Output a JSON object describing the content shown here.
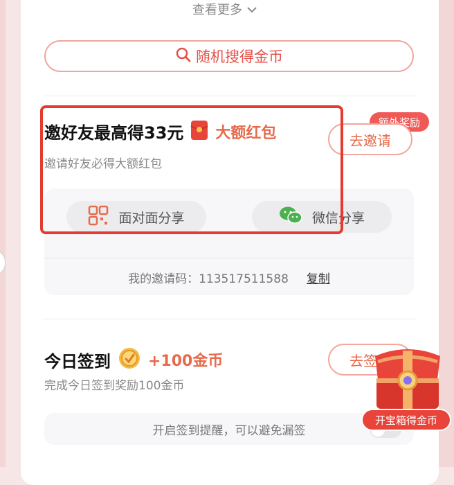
{
  "top": {
    "see_more_label": "查看更多",
    "search_button_label": "随机搜得金币"
  },
  "invite_task": {
    "title": "邀好友最高得33元",
    "tag": "大额红包",
    "description": "邀请好友必得大额红包",
    "badge": "额外奖励",
    "action_label": "去邀请",
    "share_face_label": "面对面分享",
    "share_wechat_label": "微信分享",
    "invite_code_prefix": "我的邀请码：",
    "invite_code": "113517511588",
    "copy_label": "复制"
  },
  "checkin_task": {
    "title": "今日签到",
    "reward": "+100金币",
    "description": "完成今日签到奖励100金币",
    "action_label": "去签到",
    "reminder_text": "开启签到提醒，可以避免漏签"
  },
  "floating": {
    "treasure_label": "开宝箱得金币"
  },
  "colors": {
    "accent": "#e5514a",
    "orange_text": "#e66b4c",
    "highlight_border": "#e43b30"
  }
}
